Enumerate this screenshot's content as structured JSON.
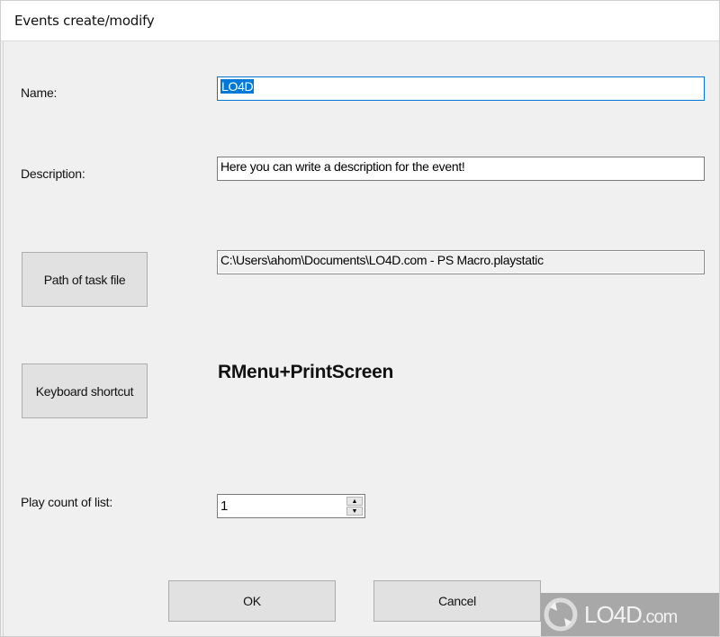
{
  "window": {
    "title": "Events create/modify"
  },
  "form": {
    "name_label": "Name:",
    "name_value": "LO4D",
    "description_label": "Description:",
    "description_value": "Here you can write a description for the event!",
    "path_button": "Path of task file",
    "path_value": "C:\\Users\\ahom\\Documents\\LO4D.com - PS Macro.playstatic",
    "shortcut_button": "Keyboard shortcut",
    "shortcut_value": "RMenu+PrintScreen",
    "play_count_label": "Play count of list:",
    "play_count_value": "1"
  },
  "footer": {
    "ok": "OK",
    "cancel": "Cancel"
  },
  "watermark": {
    "brand": "LO4D",
    "suffix": ".com"
  },
  "colors": {
    "accent": "#0078d7",
    "button_bg": "#e1e1e1",
    "window_bg": "#f0f0f0"
  }
}
